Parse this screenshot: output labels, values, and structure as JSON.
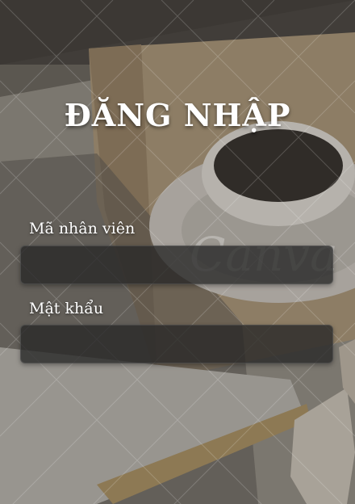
{
  "login": {
    "title": "ĐĂNG NHẬP",
    "employee_id": {
      "label": "Mã nhân viên",
      "value": "",
      "placeholder": ""
    },
    "password": {
      "label": "Mật khẩu",
      "value": "",
      "placeholder": ""
    }
  },
  "watermark": "Canva",
  "colors": {
    "title_text": "#ffffff",
    "label_text": "#ffffff",
    "input_background": "#262626",
    "backdrop": "#6b655d"
  }
}
